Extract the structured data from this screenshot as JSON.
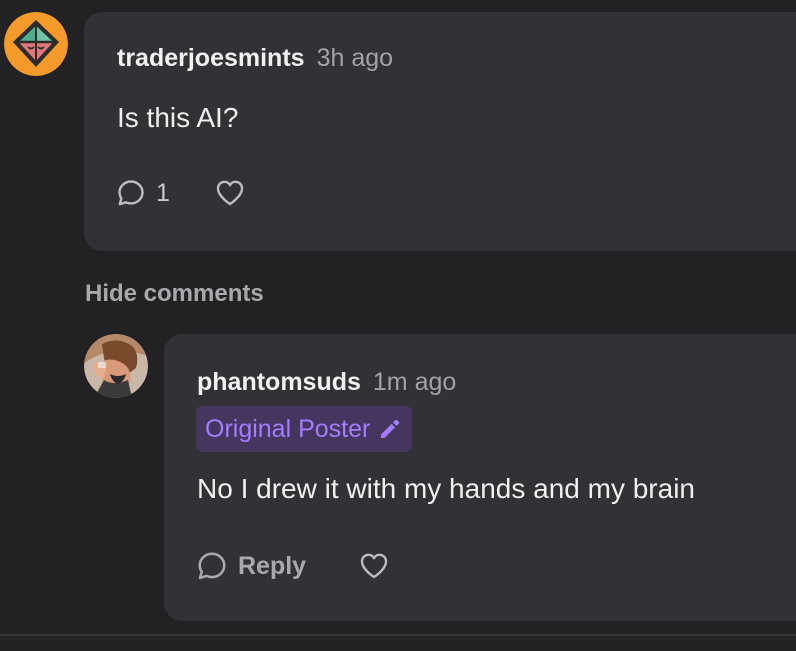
{
  "comment": {
    "username": "traderjoesmints",
    "time": "3h ago",
    "text": "Is this AI?",
    "reply_count": "1",
    "avatar_icon": "green-gem-on-orange-circle"
  },
  "toggle": {
    "hide_comments_label": "Hide comments"
  },
  "reply": {
    "username": "phantomsuds",
    "time": "1m ago",
    "badge_label": "Original Poster",
    "text": "No I drew it with my hands and my brain",
    "reply_label": "Reply",
    "avatar_icon": "illustrated-portrait"
  },
  "colors": {
    "background": "#222124",
    "card": "#323135",
    "badge_bg": "#45365f",
    "badge_text": "#a57bff",
    "avatar_orange": "#f39a2b"
  }
}
